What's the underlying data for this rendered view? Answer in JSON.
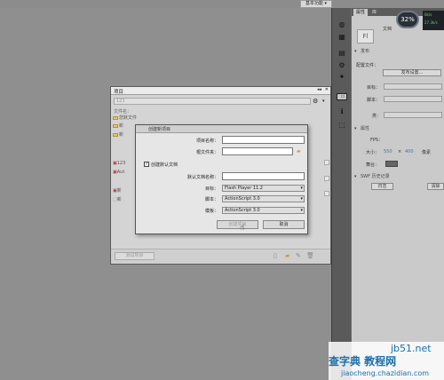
{
  "workspace_menu": "基本功能 ▾",
  "right_tabs": [
    "属性",
    "库"
  ],
  "badge_percent": "32",
  "net_stats": [
    "0k/s",
    "27.3k/s"
  ],
  "props": {
    "doc_icon": "Fl",
    "doc_label": "文档",
    "publish_header": "发布",
    "profile_label": "配置文件：",
    "publish_settings": "发布设置...",
    "target_label": "目标：",
    "script_label": "脚本：",
    "class_label": "类：",
    "properties_header": "属性",
    "fps_label": "FPS：",
    "size_label": "大小：",
    "size_w": "550",
    "size_x": "×",
    "size_h": "400",
    "size_unit": "像素",
    "stage_label": "舞台：",
    "swf_header": "SWF 历史记录",
    "log_btn": "日志",
    "clear_btn": "清除"
  },
  "project": {
    "title": "项目",
    "select_value": "123",
    "files_label": "文件名：",
    "tree": [
      "您默文件",
      "新",
      "新",
      "123",
      "Aut",
      "新",
      "新"
    ],
    "test_btn": "测试项目"
  },
  "dialog": {
    "title": "创建新项目",
    "name_label": "项目名称：",
    "folder_label": "根文件夹：",
    "checkbox_label": "创建默认文档",
    "default_doc_label": "默认文档名称：",
    "player_label": "目标：",
    "player_value": "Flash Player 11.2",
    "script_label": "脚本：",
    "script_value": "ActionScript 3.0",
    "template_label": "模板：",
    "template_value": "ActionScript 3.0",
    "create_btn": "创建项目",
    "cancel_btn": "取消"
  },
  "watermark": {
    "site": "jb51.net",
    "brand": "查字典 教程网",
    "url": "jiaocheng.chazidian.com"
  }
}
